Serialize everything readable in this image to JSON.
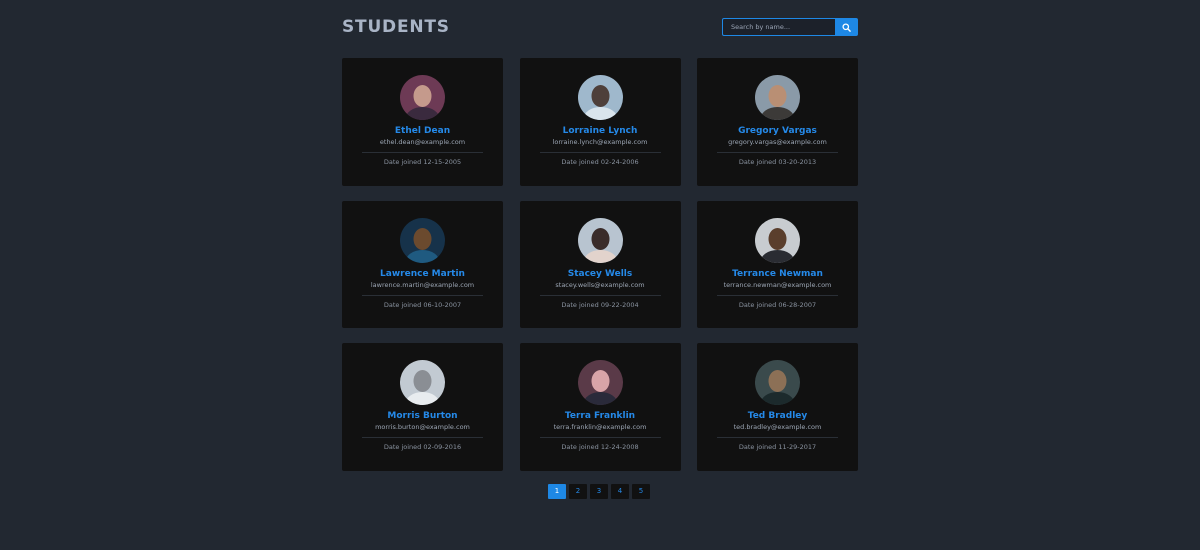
{
  "header": {
    "title": "STUDENTS",
    "search_placeholder": "Search by name...",
    "search_icon": "search-icon"
  },
  "colors": {
    "background": "#222831",
    "card": "#111111",
    "accent": "#1e88e5",
    "name": "#2589e8",
    "title": "#a9b4c6"
  },
  "students": [
    {
      "name": "Ethel Dean",
      "email": "ethel.dean@example.com",
      "joined": "Date joined 12-15-2005",
      "avatar": "avatar-photo"
    },
    {
      "name": "Lorraine Lynch",
      "email": "lorraine.lynch@example.com",
      "joined": "Date joined 02-24-2006",
      "avatar": "avatar-photo"
    },
    {
      "name": "Gregory Vargas",
      "email": "gregory.vargas@example.com",
      "joined": "Date joined 03-20-2013",
      "avatar": "avatar-photo"
    },
    {
      "name": "Lawrence Martin",
      "email": "lawrence.martin@example.com",
      "joined": "Date joined 06-10-2007",
      "avatar": "avatar-photo"
    },
    {
      "name": "Stacey Wells",
      "email": "stacey.wells@example.com",
      "joined": "Date joined 09-22-2004",
      "avatar": "avatar-photo"
    },
    {
      "name": "Terrance Newman",
      "email": "terrance.newman@example.com",
      "joined": "Date joined 06-28-2007",
      "avatar": "avatar-photo"
    },
    {
      "name": "Morris Burton",
      "email": "morris.burton@example.com",
      "joined": "Date joined 02-09-2016",
      "avatar": "avatar-photo"
    },
    {
      "name": "Terra Franklin",
      "email": "terra.franklin@example.com",
      "joined": "Date joined 12-24-2008",
      "avatar": "avatar-photo"
    },
    {
      "name": "Ted Bradley",
      "email": "ted.bradley@example.com",
      "joined": "Date joined 11-29-2017",
      "avatar": "avatar-photo"
    }
  ],
  "pagination": {
    "pages": [
      "1",
      "2",
      "3",
      "4",
      "5"
    ],
    "current": "1"
  }
}
